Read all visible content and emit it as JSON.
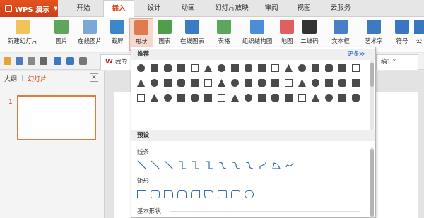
{
  "app": {
    "title": "WPS 演示"
  },
  "tabs": [
    "开始",
    "插入",
    "设计",
    "动画",
    "幻灯片放映",
    "审阅",
    "视图",
    "云服务"
  ],
  "active_tab": "插入",
  "ribbon": {
    "new_slide": "新建幻灯片",
    "picture": "图片",
    "online_picture": "在线图片",
    "screenshot": "截屏",
    "shapes": "形状",
    "chart": "图表",
    "online_chart": "在线图表",
    "table": "表格",
    "org_chart": "组织结构图",
    "map": "地图",
    "qrcode": "二维码",
    "textbox": "文本框",
    "wordart": "艺术字",
    "symbol": "符号",
    "formula": "公"
  },
  "quick": {
    "doc_tab_1": "我的",
    "doc_tab_2": "稿1 *"
  },
  "left_panel": {
    "outline": "大纲",
    "slides": "幻灯片",
    "close": "×",
    "slide_number": "1"
  },
  "dropdown": {
    "recommend": "推荐",
    "more": "更多≫",
    "preset": "预设",
    "lines": "线条",
    "rect": "矩形",
    "basic": "基本形状"
  },
  "colors": {
    "accent": "#d04a18",
    "brand_button": "#e5521f",
    "selection": "#e37a3c",
    "shape_fill": "#4a4a4a",
    "preset_stroke": "#3a6fb0",
    "link": "#2a6dc0"
  },
  "icons": [
    "search-icon",
    "save-icon",
    "undo-icon",
    "redo-icon",
    "print-icon",
    "open-icon"
  ]
}
